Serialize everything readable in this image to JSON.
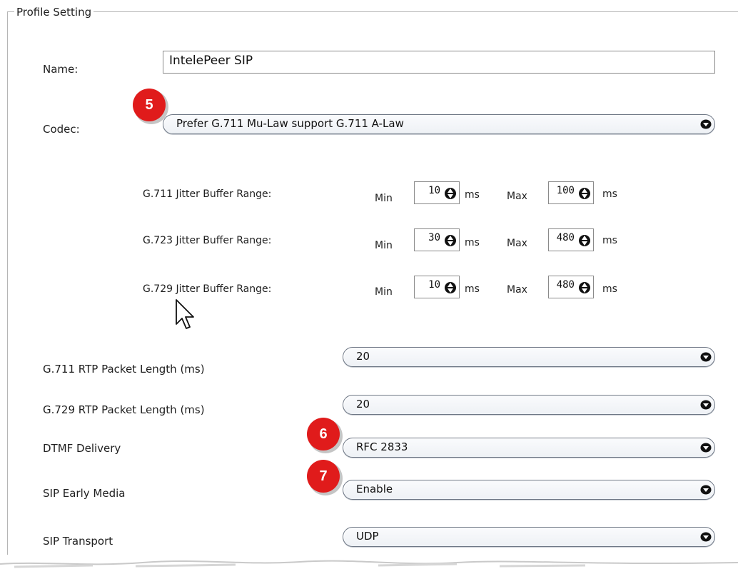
{
  "section": {
    "title": "Profile Setting"
  },
  "name": {
    "label": "Name:",
    "value": "IntelePeer SIP"
  },
  "codec": {
    "label": "Codec:",
    "value": "Prefer G.711 Mu-Law support G.711 A-Law"
  },
  "jitter": {
    "min_label": "Min",
    "max_label": "Max",
    "unit": "ms",
    "rows": [
      {
        "label": "G.711 Jitter Buffer Range:",
        "min": "10",
        "max": "100"
      },
      {
        "label": "G.723 Jitter Buffer Range:",
        "min": "30",
        "max": "480"
      },
      {
        "label": "G.729 Jitter Buffer Range:",
        "min": "10",
        "max": "480"
      }
    ]
  },
  "g711_rtp": {
    "label": "G.711 RTP Packet Length (ms)",
    "value": "20"
  },
  "g729_rtp": {
    "label": "G.729 RTP Packet Length (ms)",
    "value": "20"
  },
  "dtmf": {
    "label": "DTMF Delivery",
    "value": "RFC 2833"
  },
  "early_media": {
    "label": "SIP Early Media",
    "value": "Enable"
  },
  "transport": {
    "label": "SIP Transport",
    "value": "UDP"
  },
  "callouts": {
    "codec": "5",
    "dtmf": "6",
    "early_media": "7"
  },
  "colors": {
    "badge": "#e01b1b",
    "select_border": "#6e7785"
  }
}
